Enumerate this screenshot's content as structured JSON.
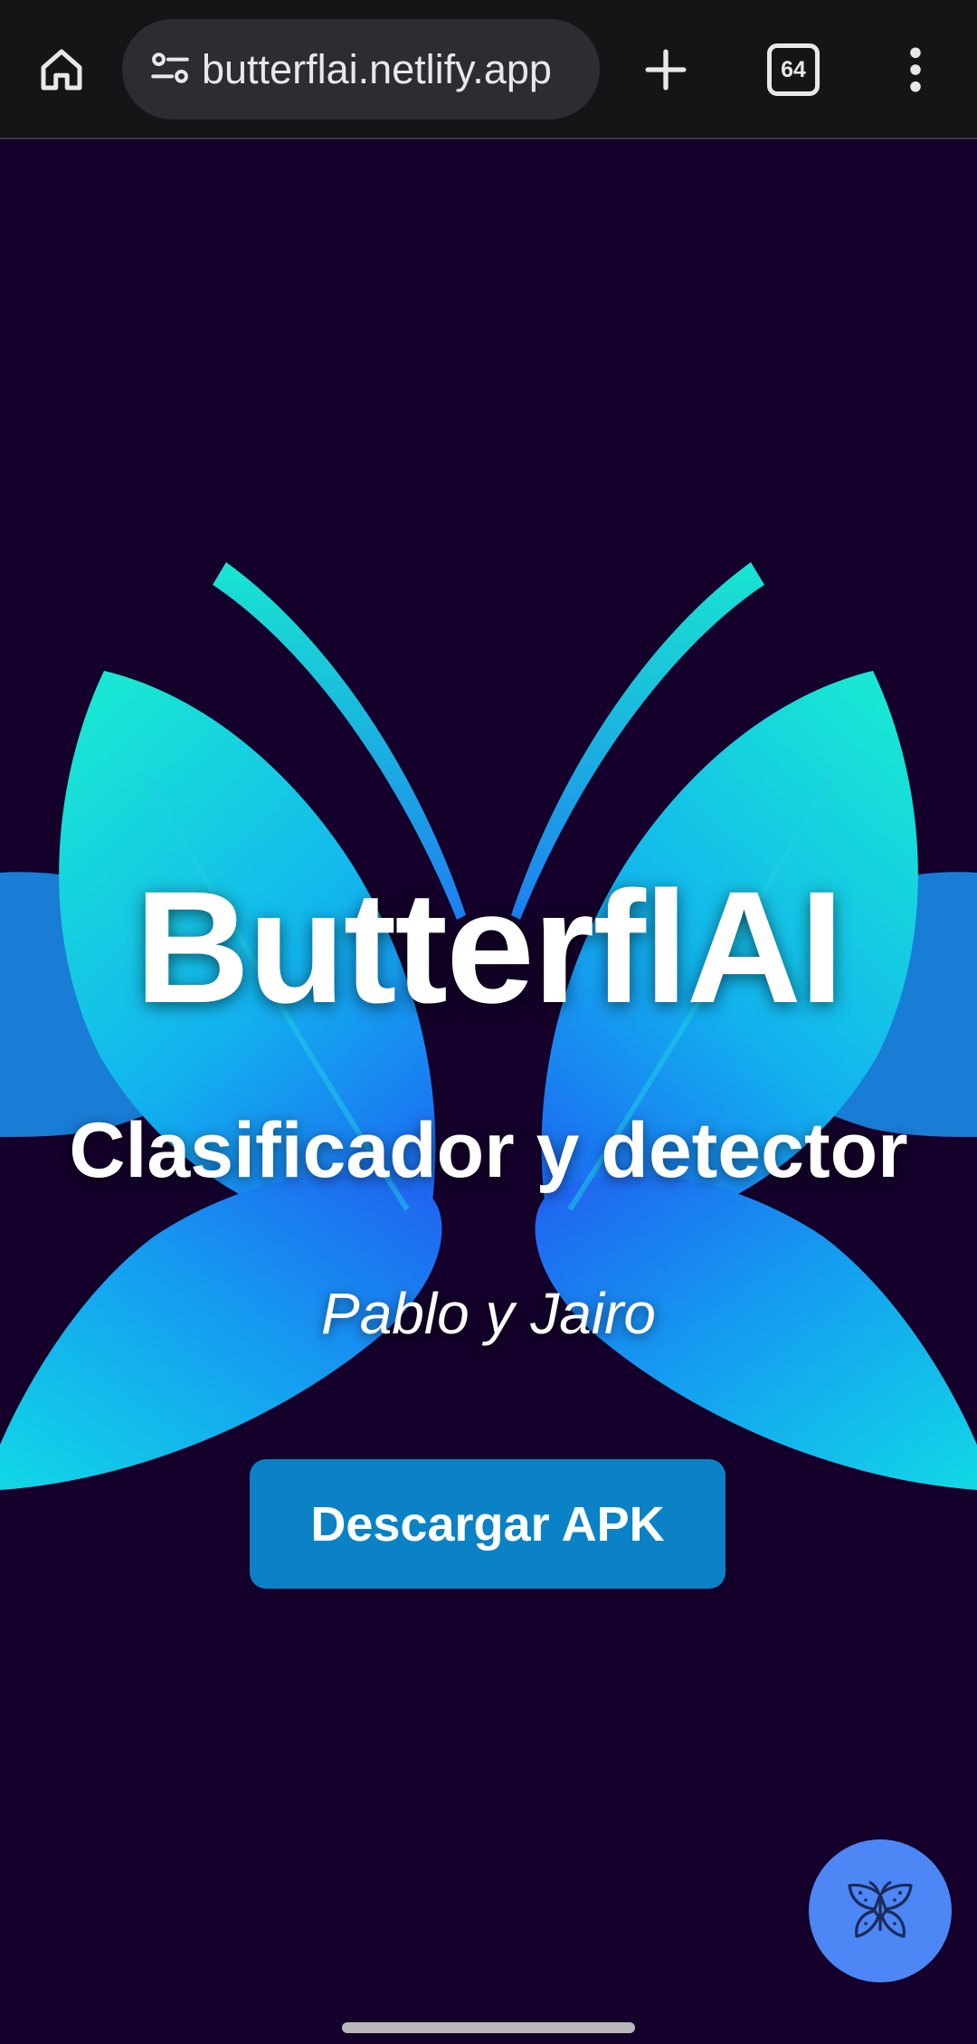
{
  "browser": {
    "url": "butterflai.netlify.app",
    "tab_count": "64",
    "icons": {
      "home": "home-icon",
      "site_info": "site-settings-icon",
      "new_tab": "plus-icon",
      "tabs": "tab-switcher-icon",
      "menu": "more-vert-icon"
    }
  },
  "hero": {
    "title": "ButterflAI",
    "subtitle": "Clasificador y detector",
    "authors": "Pablo y Jairo",
    "download_label": "Descargar APK",
    "logo_icon": "butterfly-logo-icon",
    "fab_icon": "butterfly-icon"
  },
  "colors": {
    "background": "#14002a",
    "browser_bar": "#151518",
    "url_pill": "#2b2d33",
    "button": "#0b82c6",
    "fab": "#4d86f5",
    "wing_light": "#19e3d6",
    "wing_dark": "#1d6ef2"
  }
}
